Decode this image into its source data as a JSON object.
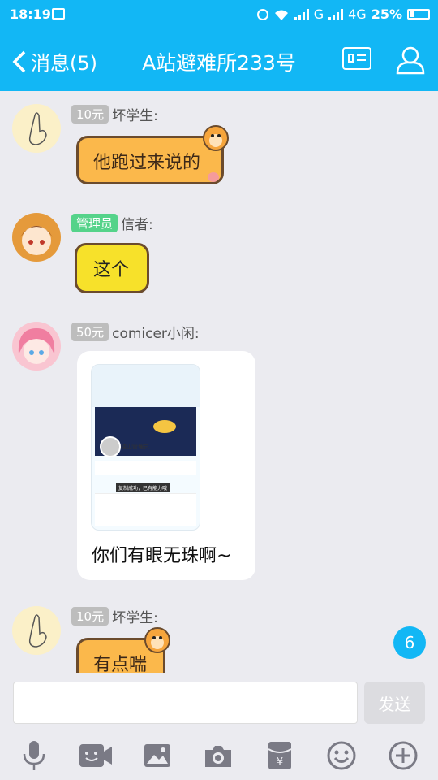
{
  "status": {
    "time": "18:19",
    "network1": "G",
    "network2": "4G",
    "battery": "25%"
  },
  "nav": {
    "back_label": "消息(5)",
    "title": "A站避难所233号"
  },
  "messages": [
    {
      "tag": "10元",
      "sender": "坏学生:",
      "text": "他跑过来说的"
    },
    {
      "tag": "管理员",
      "sender": "信者:",
      "text": "这个"
    },
    {
      "tag": "50元",
      "sender": "comicer小闲:",
      "text": "你们有眼无珠啊~"
    },
    {
      "tag": "10元",
      "sender": "坏学生:",
      "text": "有点喘"
    }
  ],
  "embedded_screenshot": {
    "profile_name": "独山管理员",
    "toast": "复制成功，已有能力哦"
  },
  "unread_badge": "6",
  "input": {
    "value": "",
    "send_label": "发送"
  },
  "toolbar": [
    "microphone-icon",
    "video-icon",
    "image-icon",
    "camera-icon",
    "red-packet-icon",
    "emoji-icon",
    "plus-icon"
  ],
  "colors": {
    "accent": "#12b7f5",
    "background": "#ebebf0"
  }
}
